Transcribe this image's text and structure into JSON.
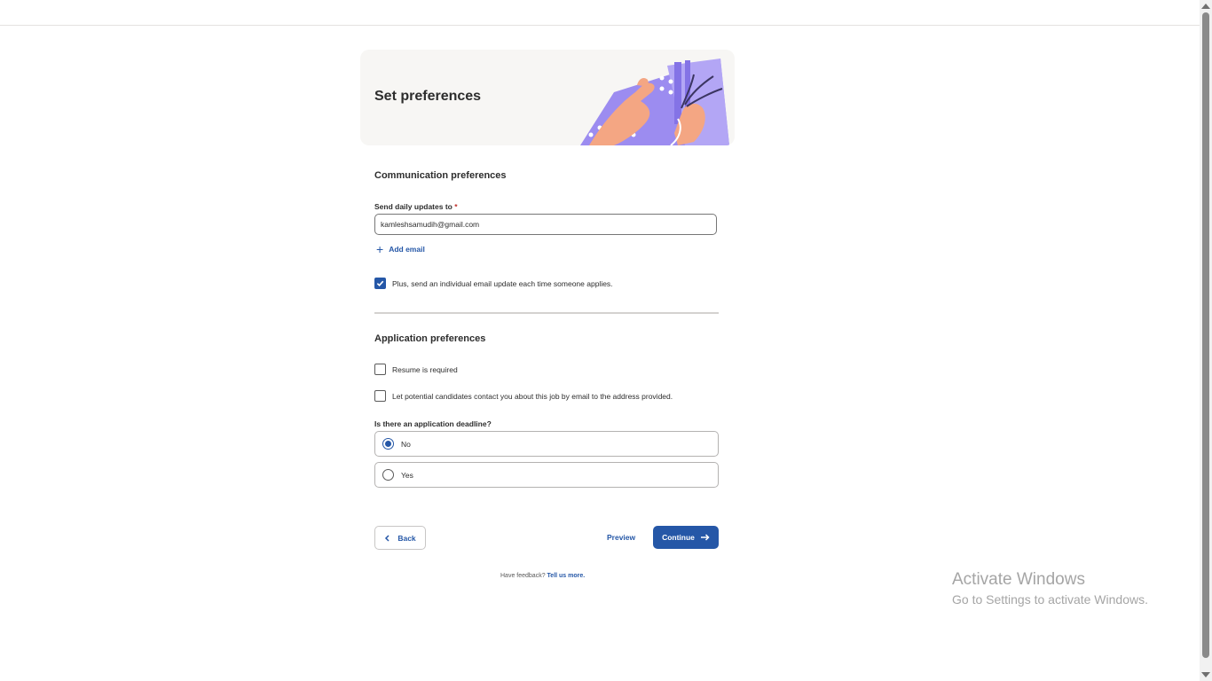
{
  "header": {
    "title": "Set preferences",
    "illustration": "hands-cutting-wires-illustration"
  },
  "communication": {
    "section_title": "Communication preferences",
    "daily_updates_label": "Send daily updates to",
    "required_mark": "*",
    "email_value": "kamleshsamudih@gmail.com",
    "add_email_label": "Add email",
    "individual_update_label": "Plus, send an individual email update each time someone applies.",
    "individual_update_checked": true
  },
  "application": {
    "section_title": "Application preferences",
    "resume_label": "Resume is required",
    "resume_checked": false,
    "contact_label": "Let potential candidates contact you about this job by email to the address provided.",
    "contact_checked": false,
    "deadline_question": "Is there an application deadline?",
    "deadline_options": [
      {
        "label": "No",
        "selected": true
      },
      {
        "label": "Yes",
        "selected": false
      }
    ]
  },
  "actions": {
    "back_label": "Back",
    "preview_label": "Preview",
    "continue_label": "Continue"
  },
  "feedback": {
    "prompt": "Have feedback?",
    "link_label": "Tell us more."
  },
  "windows_watermark": {
    "title": "Activate Windows",
    "subtitle": "Go to Settings to activate Windows."
  },
  "colors": {
    "accent": "#2557a7",
    "illustration_purple": "#9c8cf0",
    "illustration_skin": "#f4a683"
  }
}
